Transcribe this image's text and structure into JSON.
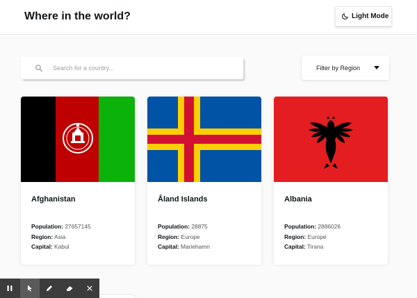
{
  "header": {
    "title": "Where in the world?",
    "mode_label": "Light Mode"
  },
  "search": {
    "placeholder": "Search for a country..."
  },
  "filter": {
    "label": "Filter by Region"
  },
  "labels": {
    "population": "Population:",
    "region": "Region:",
    "capital": "Capital:"
  },
  "countries": [
    {
      "name": "Afghanistan",
      "population": "27657145",
      "region": "Asia",
      "capital": "Kabul"
    },
    {
      "name": "Åland Islands",
      "population": "28875",
      "region": "Europe",
      "capital": "Mariehamn"
    },
    {
      "name": "Albania",
      "population": "2886026",
      "region": "Europe",
      "capital": "Tirana"
    }
  ],
  "toolbar": {
    "icons": [
      "pause-icon",
      "cursor-icon",
      "pencil-icon",
      "eraser-icon",
      "close-icon"
    ]
  },
  "colors": {
    "background": "#fafafa",
    "text": "#111517",
    "toolbar": "#3c3c3c"
  }
}
